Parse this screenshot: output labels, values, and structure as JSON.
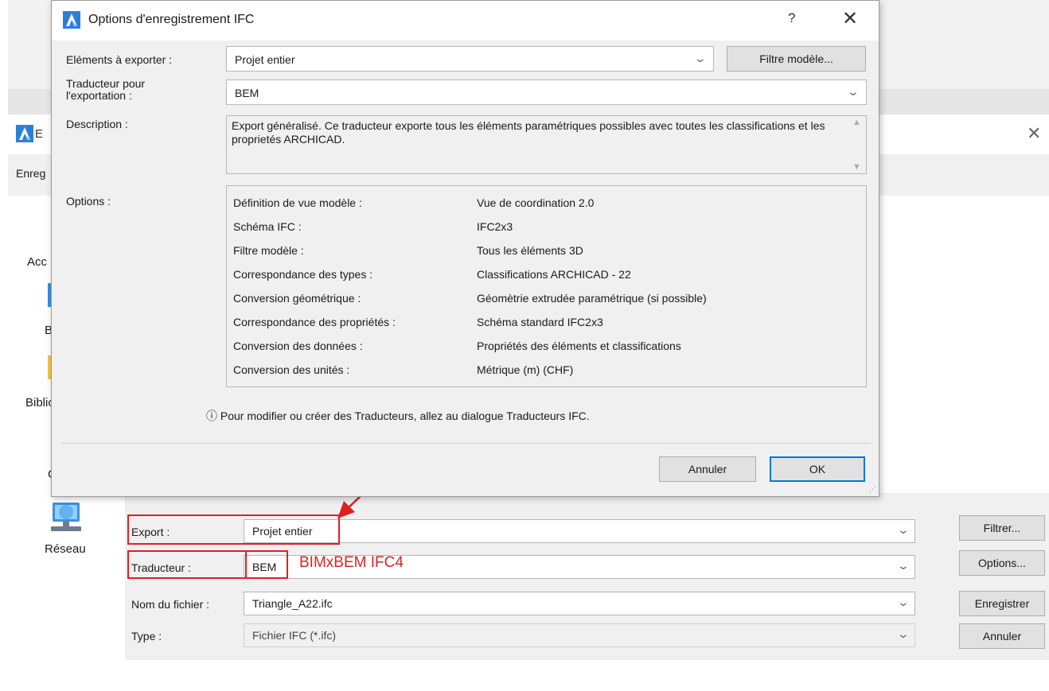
{
  "save_dialog": {
    "title_fragment": "E",
    "toolbar_fragment": "Enreg",
    "nav": {
      "fragment_1": "Acc",
      "fragment_2": "B",
      "fragment_3": "Biblio",
      "fragment_4": "C",
      "network_label": "Réseau"
    },
    "fields": {
      "export_label": "Export :",
      "export_value": "Projet entier",
      "translator_label": "Traducteur :",
      "translator_value": "BEM",
      "filename_label": "Nom du fichier :",
      "filename_value": "Triangle_A22.ifc",
      "type_label": "Type :",
      "type_value": "Fichier IFC (*.ifc)"
    },
    "buttons": {
      "filter": "Filtrer...",
      "options": "Options...",
      "save": "Enregistrer",
      "cancel": "Annuler"
    }
  },
  "annotation": {
    "text": "BIMxBEM IFC4",
    "color": "#e02020"
  },
  "ifc_dialog": {
    "title": "Options d'enregistrement IFC",
    "help_glyph": "?",
    "close_glyph": "✕",
    "elements_label": "Eléments à exporter :",
    "elements_value": "Projet entier",
    "filter_button": "Filtre modèle...",
    "translator_label": "Traducteur pour l'exportation :",
    "translator_value": "BEM",
    "description_label": "Description :",
    "description_text": "Export généralisé. Ce traducteur exporte tous les éléments paramétriques possibles avec toutes les classifications et les proprietés ARCHICAD.",
    "options_label": "Options :",
    "options": [
      {
        "key": "Définition de vue modèle :",
        "value": "Vue de coordination 2.0"
      },
      {
        "key": "Schéma IFC :",
        "value": "IFC2x3"
      },
      {
        "key": "Filtre modèle :",
        "value": "Tous les éléments 3D"
      },
      {
        "key": "Correspondance des types :",
        "value": "Classifications ARCHICAD - 22"
      },
      {
        "key": "Conversion géométrique :",
        "value": "Géomètrie extrudée paramétrique (si possible)"
      },
      {
        "key": "Correspondance des propriétés :",
        "value": "Schéma standard IFC2x3"
      },
      {
        "key": "Conversion des données :",
        "value": "Propriétés des éléments et classifications"
      },
      {
        "key": "Conversion des unités :",
        "value": "Métrique (m) (CHF)"
      }
    ],
    "info_text": "ⓘ Pour modifier ou créer des Traducteurs, allez au dialogue Traducteurs IFC.",
    "cancel_button": "Annuler",
    "ok_button": "OK"
  },
  "colors": {
    "accent": "#0078d7",
    "archicad_icon": "#1e88e5",
    "highlight": "#e02020",
    "dialog_bg": "#f0f0f0"
  },
  "icons": {
    "app": "archicad-icon",
    "network": "network-icon",
    "chevron": "chevron-down-icon",
    "close": "close-icon"
  }
}
